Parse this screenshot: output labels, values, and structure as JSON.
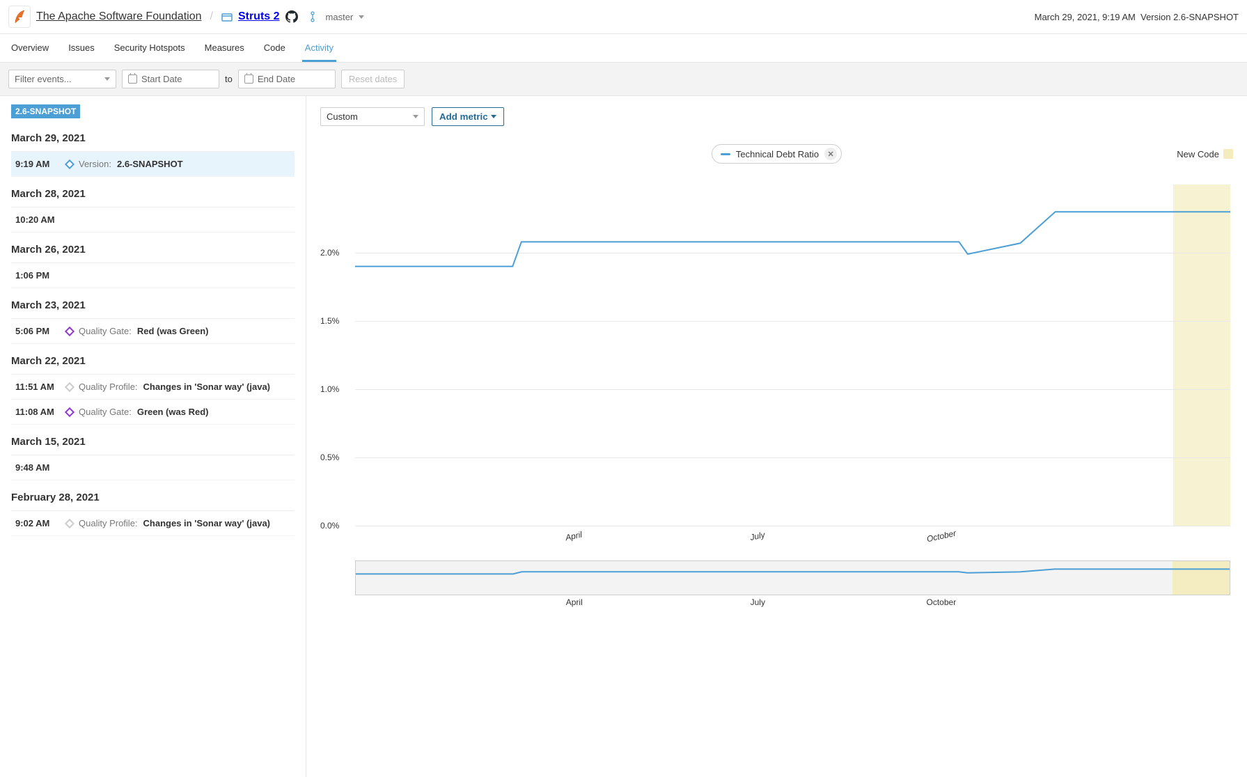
{
  "header": {
    "org": "The Apache Software Foundation",
    "project": "Struts 2",
    "branch": "master",
    "timestamp": "March 29, 2021, 9:19 AM",
    "version": "Version 2.6-SNAPSHOT"
  },
  "nav": {
    "overview": "Overview",
    "issues": "Issues",
    "security": "Security Hotspots",
    "measures": "Measures",
    "code": "Code",
    "activity": "Activity"
  },
  "filters": {
    "events_placeholder": "Filter events...",
    "start_placeholder": "Start Date",
    "to": "to",
    "end_placeholder": "End Date",
    "reset": "Reset dates"
  },
  "sidebar": {
    "version": "2.6-SNAPSHOT",
    "days": [
      {
        "date": "March 29, 2021",
        "events": [
          {
            "time": "9:19 AM",
            "icon": "blue",
            "label": "Version:",
            "value": "2.6-SNAPSHOT",
            "selected": true
          }
        ]
      },
      {
        "date": "March 28, 2021",
        "events": [
          {
            "time": "10:20 AM"
          }
        ]
      },
      {
        "date": "March 26, 2021",
        "events": [
          {
            "time": "1:06 PM"
          }
        ]
      },
      {
        "date": "March 23, 2021",
        "events": [
          {
            "time": "5:06 PM",
            "icon": "purple",
            "label": "Quality Gate:",
            "value": "Red (was Green)"
          }
        ]
      },
      {
        "date": "March 22, 2021",
        "events": [
          {
            "time": "11:51 AM",
            "icon": "grey",
            "label": "Quality Profile:",
            "value": "Changes in 'Sonar way' (java)"
          },
          {
            "time": "11:08 AM",
            "icon": "purple",
            "label": "Quality Gate:",
            "value": "Green (was Red)"
          }
        ]
      },
      {
        "date": "March 15, 2021",
        "events": [
          {
            "time": "9:48 AM"
          }
        ]
      },
      {
        "date": "February 28, 2021",
        "events": [
          {
            "time": "9:02 AM",
            "icon": "grey",
            "label": "Quality Profile:",
            "value": "Changes in 'Sonar way' (java)"
          }
        ]
      }
    ]
  },
  "chart_controls": {
    "mode": "Custom",
    "add_metric": "Add metric",
    "pill": "Technical Debt Ratio",
    "newcode_label": "New Code"
  },
  "chart_data": {
    "type": "line",
    "title": "",
    "xlabel": "",
    "ylabel": "",
    "ylim": [
      0.0,
      2.5
    ],
    "y_ticks": [
      "0.0%",
      "0.5%",
      "1.0%",
      "1.5%",
      "2.0%"
    ],
    "x_ticks": [
      "April",
      "July",
      "October"
    ],
    "legend": [
      "Technical Debt Ratio"
    ],
    "series": [
      {
        "name": "Technical Debt Ratio",
        "color": "#4b9fd5",
        "x": [
          0.0,
          0.18,
          0.19,
          0.69,
          0.7,
          0.76,
          0.8,
          0.86,
          1.0
        ],
        "values": [
          1.9,
          1.9,
          2.08,
          2.08,
          1.99,
          2.07,
          2.3,
          2.3,
          2.3
        ]
      }
    ],
    "newcode_start_frac": 0.935,
    "x_tick_positions": [
      0.25,
      0.46,
      0.67
    ],
    "overview_x_ticks": [
      "April",
      "July",
      "October"
    ],
    "overview_x_positions": [
      0.25,
      0.46,
      0.67
    ]
  }
}
